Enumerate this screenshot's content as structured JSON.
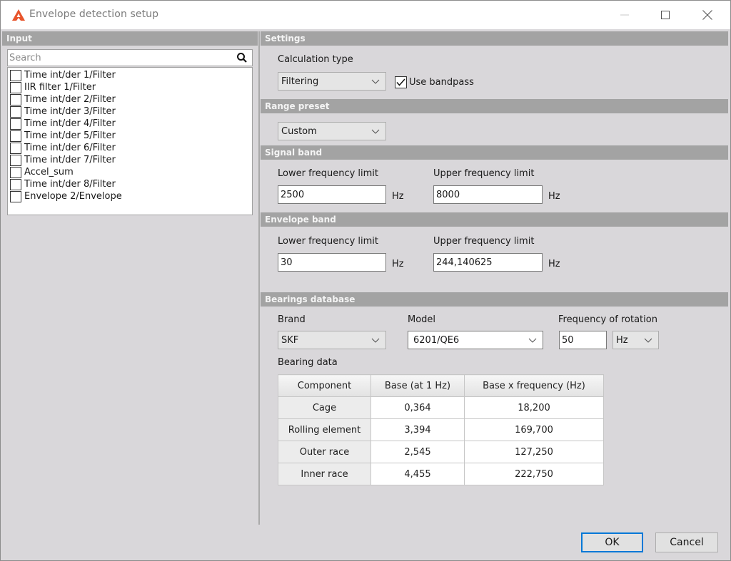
{
  "window": {
    "title": "Envelope detection setup",
    "controls": {
      "minimize": "minimize",
      "maximize": "maximize",
      "close": "close"
    },
    "brand_color": "#e8542b"
  },
  "input": {
    "header": "Input",
    "search_placeholder": "Search",
    "search_value": "",
    "items": [
      {
        "label": "Time int/der 1/Filter",
        "checked": false
      },
      {
        "label": "IIR filter 1/Filter",
        "checked": false
      },
      {
        "label": "Time int/der 2/Filter",
        "checked": false
      },
      {
        "label": "Time int/der 3/Filter",
        "checked": false
      },
      {
        "label": "Time int/der 4/Filter",
        "checked": false
      },
      {
        "label": "Time int/der 5/Filter",
        "checked": false
      },
      {
        "label": "Time int/der 6/Filter",
        "checked": false
      },
      {
        "label": "Time int/der 7/Filter",
        "checked": false
      },
      {
        "label": "Accel_sum",
        "checked": false
      },
      {
        "label": "Time int/der 8/Filter",
        "checked": false
      },
      {
        "label": "Envelope 2/Envelope",
        "checked": false
      }
    ]
  },
  "settings": {
    "header": "Settings",
    "calculation_type_label": "Calculation type",
    "calculation_type_value": "Filtering",
    "use_bandpass_label": "Use bandpass",
    "use_bandpass_checked": true
  },
  "range_preset": {
    "header": "Range preset",
    "value": "Custom"
  },
  "signal_band": {
    "header": "Signal band",
    "lower_label": "Lower frequency limit",
    "lower_value": "2500",
    "lower_unit": "Hz",
    "upper_label": "Upper frequency limit",
    "upper_value": "8000",
    "upper_unit": "Hz"
  },
  "envelope_band": {
    "header": "Envelope band",
    "lower_label": "Lower frequency limit",
    "lower_value": "30",
    "lower_unit": "Hz",
    "upper_label": "Upper frequency limit",
    "upper_value": "244,140625",
    "upper_unit": "Hz"
  },
  "bearings": {
    "header": "Bearings database",
    "brand_label": "Brand",
    "brand_value": "SKF",
    "model_label": "Model",
    "model_value": "6201/QE6",
    "rotation_label": "Frequency of rotation",
    "rotation_value": "50",
    "rotation_unit": "Hz",
    "bearing_data_label": "Bearing data",
    "table": {
      "columns": [
        "Component",
        "Base (at 1 Hz)",
        "Base x frequency (Hz)"
      ],
      "rows": [
        [
          "Cage",
          "0,364",
          "18,200"
        ],
        [
          "Rolling element",
          "3,394",
          "169,700"
        ],
        [
          "Outer race",
          "2,545",
          "127,250"
        ],
        [
          "Inner race",
          "4,455",
          "222,750"
        ]
      ]
    }
  },
  "footer": {
    "ok_label": "OK",
    "cancel_label": "Cancel"
  }
}
